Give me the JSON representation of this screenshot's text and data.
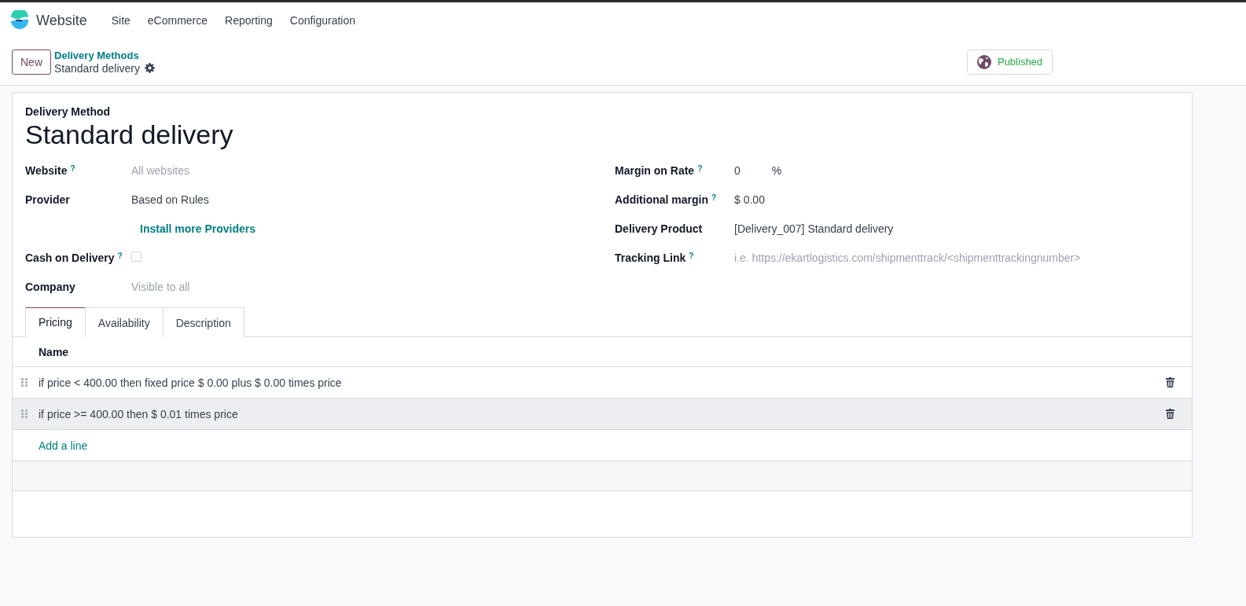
{
  "navbar": {
    "app_name": "Website",
    "menu": [
      "Site",
      "eCommerce",
      "Reporting",
      "Configuration"
    ]
  },
  "control_panel": {
    "new_button": "New",
    "breadcrumb": "Delivery Methods",
    "record_title": "Standard delivery",
    "status_button": {
      "label": "Published",
      "on": true
    }
  },
  "form": {
    "record_type": "Delivery Method",
    "name": "Standard delivery",
    "left_fields": [
      {
        "kind": "input",
        "label": "Website",
        "help": "?",
        "placeholder": "All websites"
      },
      {
        "kind": "value",
        "label": "Provider",
        "value": "Based on Rules"
      },
      {
        "kind": "link",
        "value": "Install more Providers"
      },
      {
        "kind": "checkbox",
        "label": "Cash on Delivery",
        "help": "?",
        "checked": false
      },
      {
        "kind": "input",
        "label": "Company",
        "placeholder": "Visible to all"
      }
    ],
    "right_fields": [
      {
        "kind": "value",
        "label": "Margin on Rate",
        "help": "?",
        "value": "0",
        "unit": "%"
      },
      {
        "kind": "value",
        "label": "Additional margin",
        "help": "?",
        "value": "$ 0.00"
      },
      {
        "kind": "value",
        "label": "Delivery Product",
        "value": "[Delivery_007] Standard delivery"
      },
      {
        "kind": "input",
        "label": "Tracking Link",
        "help": "?",
        "placeholder": "i.e. https://ekartlogistics.com/shipmenttrack/<shipmenttrackingnumber>"
      }
    ],
    "tabs": [
      {
        "label": "Pricing",
        "selected": true
      },
      {
        "label": "Availability",
        "selected": false
      },
      {
        "label": "Description",
        "selected": false
      }
    ],
    "table": {
      "columns": [
        "Name"
      ],
      "rows": [
        {
          "name": "if price < 400.00 then fixed price $ 0.00 plus $ 0.00 times price",
          "highlighted": false
        },
        {
          "name": "if price >= 400.00 then $ 0.01 times price",
          "highlighted": true
        }
      ],
      "add_line": "Add a line"
    }
  }
}
